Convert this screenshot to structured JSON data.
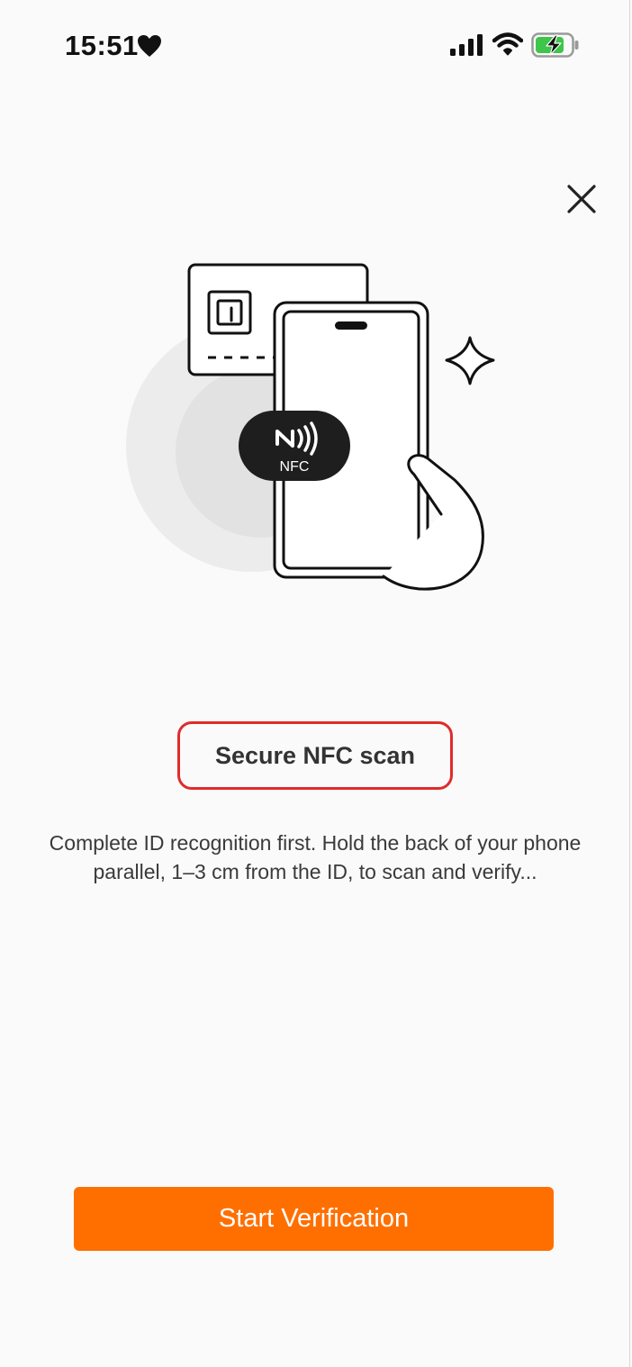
{
  "status_bar": {
    "time": "15:51",
    "icons": [
      "heart-icon",
      "signal-icon",
      "wifi-icon",
      "battery-charging-icon"
    ]
  },
  "header": {
    "close_icon": "close-icon"
  },
  "illustration": {
    "nfc_label": "NFC"
  },
  "content": {
    "title": "Secure NFC scan",
    "description": "Complete ID recognition first. Hold the back of your phone parallel, 1–3 cm from the ID, to scan and verify..."
  },
  "footer": {
    "button_label": "Start Verification"
  },
  "colors": {
    "accent": "#ff6f00",
    "highlight_border": "#e02b2b",
    "battery_fill": "#3ec54a"
  }
}
